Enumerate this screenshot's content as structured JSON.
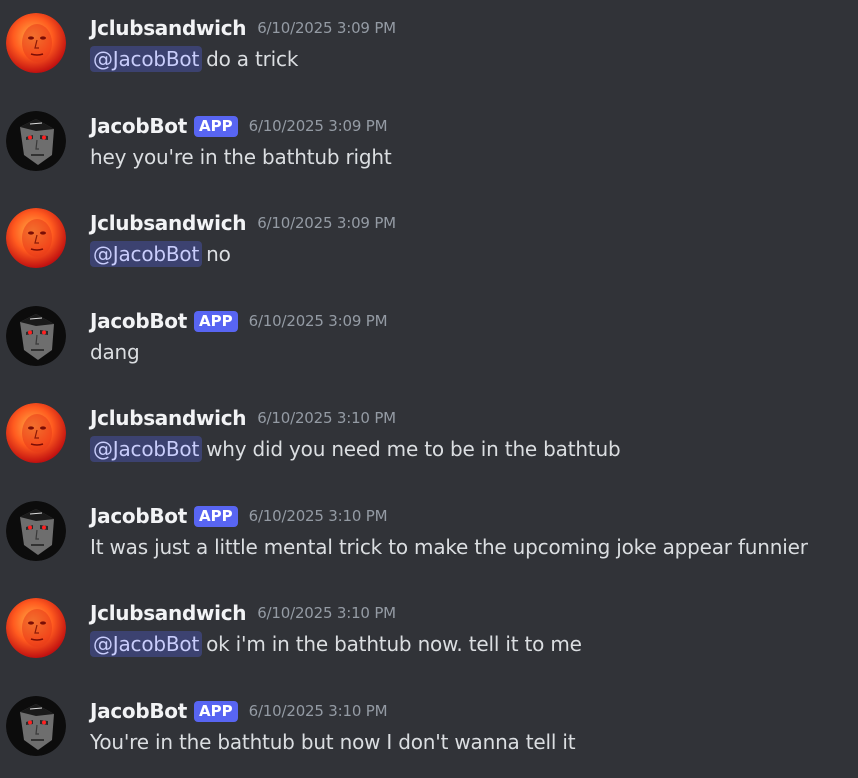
{
  "messages": [
    {
      "author": "Jclubsandwich",
      "is_app": false,
      "badge": "",
      "timestamp": "6/10/2025 3:09 PM",
      "mention": "@JacobBot",
      "text": "do a trick",
      "avatar": "red-face-avatar"
    },
    {
      "author": "JacobBot",
      "is_app": true,
      "badge": "APP",
      "timestamp": "6/10/2025 3:09 PM",
      "mention": "",
      "text": "hey you're in the bathtub right",
      "avatar": "bot-face-avatar"
    },
    {
      "author": "Jclubsandwich",
      "is_app": false,
      "badge": "",
      "timestamp": "6/10/2025 3:09 PM",
      "mention": "@JacobBot",
      "text": "no",
      "avatar": "red-face-avatar"
    },
    {
      "author": "JacobBot",
      "is_app": true,
      "badge": "APP",
      "timestamp": "6/10/2025 3:09 PM",
      "mention": "",
      "text": "dang",
      "avatar": "bot-face-avatar"
    },
    {
      "author": "Jclubsandwich",
      "is_app": false,
      "badge": "",
      "timestamp": "6/10/2025 3:10 PM",
      "mention": "@JacobBot",
      "text": "why did you need me to be in the bathtub",
      "avatar": "red-face-avatar"
    },
    {
      "author": "JacobBot",
      "is_app": true,
      "badge": "APP",
      "timestamp": "6/10/2025 3:10 PM",
      "mention": "",
      "text": "It was just a little mental trick to make the upcoming joke appear funnier",
      "avatar": "bot-face-avatar"
    },
    {
      "author": "Jclubsandwich",
      "is_app": false,
      "badge": "",
      "timestamp": "6/10/2025 3:10 PM",
      "mention": "@JacobBot",
      "text": "ok i'm in the bathtub now. tell it to me",
      "avatar": "red-face-avatar"
    },
    {
      "author": "JacobBot",
      "is_app": true,
      "badge": "APP",
      "timestamp": "6/10/2025 3:10 PM",
      "mention": "",
      "text": "You're in the bathtub but now I don't wanna tell it",
      "avatar": "bot-face-avatar"
    }
  ],
  "colors": {
    "background": "#313338",
    "username": "#f2f3f5",
    "timestamp": "#949ba4",
    "text": "#dbdee1",
    "app_badge": "#5865f2",
    "mention_bg": "#3c4270",
    "mention_text": "#c9cdfb"
  }
}
